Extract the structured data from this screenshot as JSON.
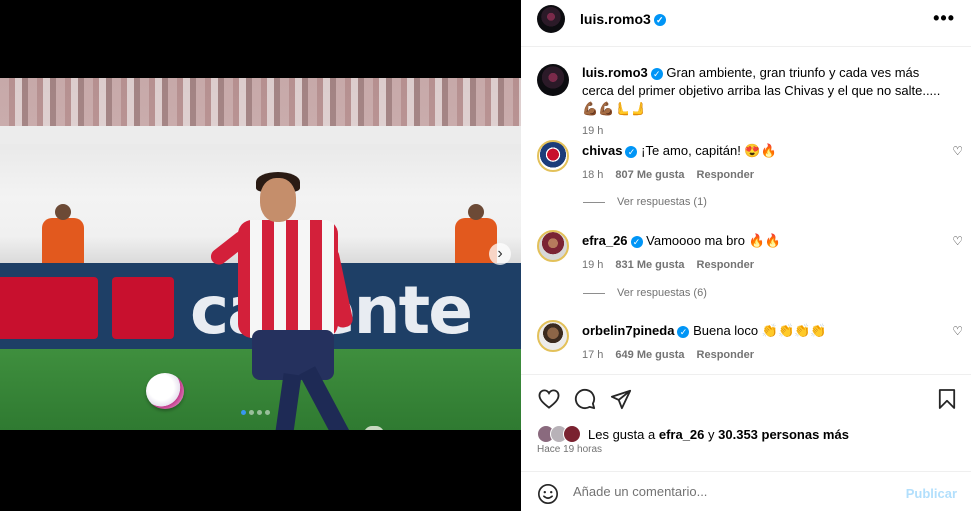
{
  "post": {
    "username": "luis.romo3",
    "more_label": "•••",
    "caption": "Gran ambiente, gran triunfo y cada ves más cerca del primer objetivo arriba las Chivas y el que no salte.....",
    "caption_emojis": "💪🏾💪🏾🫷🫸",
    "caption_time": "19 h"
  },
  "media": {
    "board_text": "caliente",
    "image_count": 4,
    "active_index": 0
  },
  "comments": [
    {
      "username": "chivas",
      "text": "¡Te amo, capitán! 😍🔥",
      "time": "18 h",
      "likes": "807 Me gusta",
      "reply": "Responder",
      "view_replies": "Ver respuestas (1)"
    },
    {
      "username": "efra_26",
      "text": "Vamoooo ma bro 🔥🔥",
      "time": "19 h",
      "likes": "831 Me gusta",
      "reply": "Responder",
      "view_replies": "Ver respuestas (6)"
    },
    {
      "username": "orbelin7pineda",
      "text": "Buena loco 👏👏👏👏",
      "time": "17 h",
      "likes": "649 Me gusta",
      "reply": "Responder"
    }
  ],
  "likes": {
    "prefix": "Les gusta a",
    "user": "efra_26",
    "connector": "y",
    "count": "30.353 personas más"
  },
  "post_time": "Hace 19 horas",
  "comment_box": {
    "placeholder": "Añade un comentario...",
    "publish_label": "Publicar"
  },
  "colors": {
    "accent": "#0095f6",
    "publish_disabled": "#b2dffc",
    "secondary_text": "#737373"
  },
  "icons": [
    "more-icon",
    "verified-icon",
    "heart-icon",
    "comment-icon",
    "share-icon",
    "bookmark-icon",
    "emoji-icon",
    "next-arrow-icon"
  ]
}
